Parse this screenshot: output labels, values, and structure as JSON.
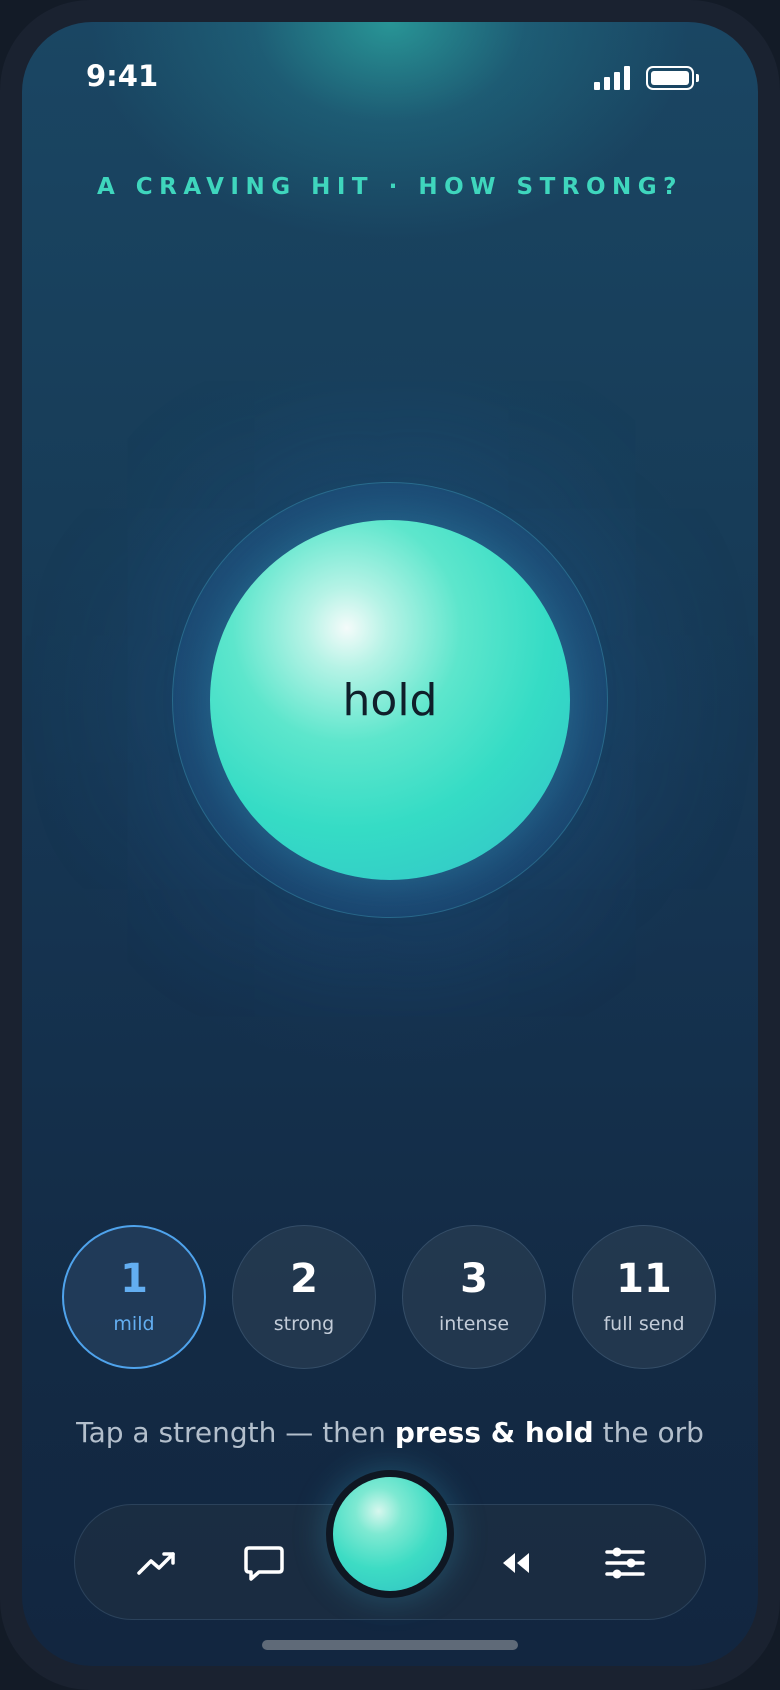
{
  "status_bar": {
    "time": "9:41"
  },
  "prompt": "A CRAVING HIT · HOW STRONG?",
  "orb": {
    "label": "hold"
  },
  "strengths": [
    {
      "value": "1",
      "label": "mild",
      "selected": true
    },
    {
      "value": "2",
      "label": "strong",
      "selected": false
    },
    {
      "value": "3",
      "label": "intense",
      "selected": false
    },
    {
      "value": "11",
      "label": "full send",
      "selected": false
    }
  ],
  "hint": {
    "before": "Tap a strength — then ",
    "emphasis": "press & hold",
    "after": " the orb"
  },
  "tab_bar": {
    "items": [
      {
        "icon": "trend-up-icon"
      },
      {
        "icon": "chat-bubble-icon"
      },
      {
        "icon": "orb-icon"
      },
      {
        "icon": "rewind-icon"
      },
      {
        "icon": "sliders-icon"
      }
    ]
  },
  "colors": {
    "accent_teal": "#3fd6bd",
    "selected_blue": "#4fa3ec",
    "orb_teal": "#35dcc5"
  }
}
